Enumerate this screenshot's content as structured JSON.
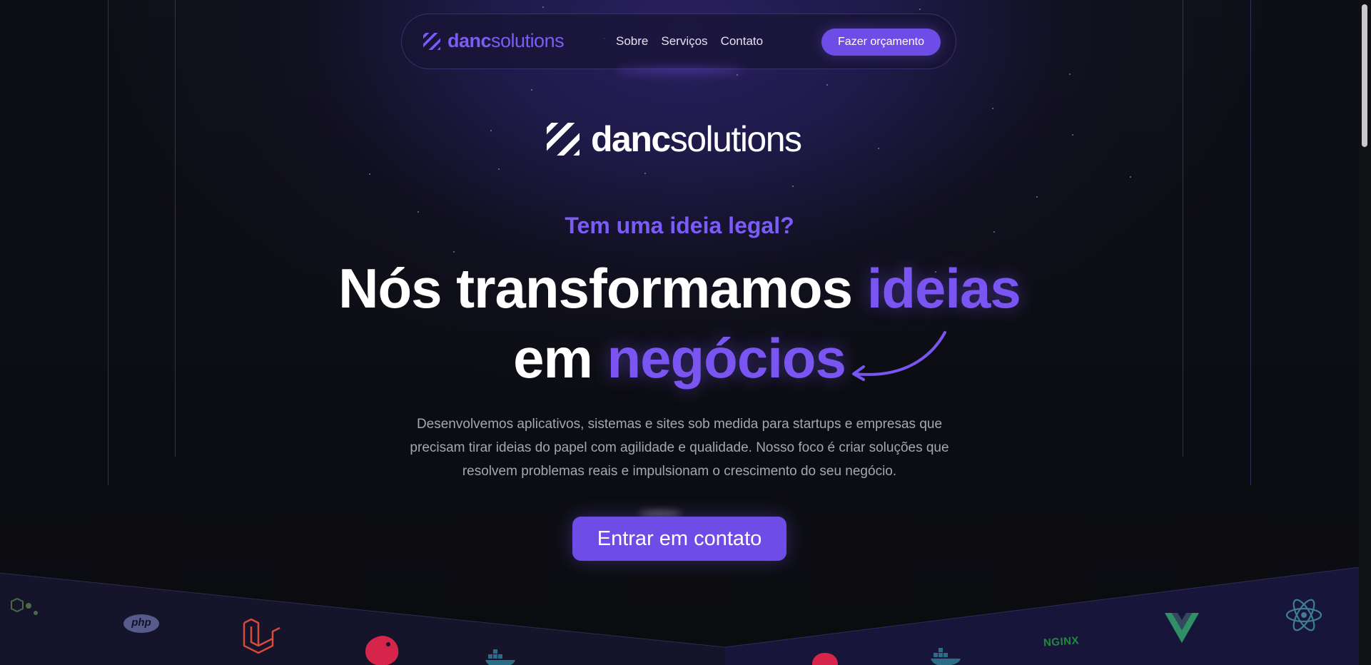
{
  "header": {
    "brand": {
      "bold": "danc",
      "light": "solutions"
    },
    "nav": [
      {
        "label": "Sobre"
      },
      {
        "label": "Serviços"
      },
      {
        "label": "Contato"
      }
    ],
    "cta_label": "Fazer orçamento"
  },
  "hero": {
    "logo": {
      "bold": "danc",
      "light": "solutions"
    },
    "eyebrow": "Tem uma ideia legal?",
    "headline": {
      "part1": "Nós transformamos ",
      "highlight1": "ideias",
      "part2": "em ",
      "highlight2": "negócios"
    },
    "description": "Desenvolvemos aplicativos, sistemas e sites sob medida para startups e empresas que precisam tirar ideias do papel com agilidade e qualidade. Nosso foco é criar soluções que resolvem problemas reais e impulsionam o crescimento do seu negócio.",
    "cta_label": "Entrar em contato"
  },
  "tech_icons": {
    "php_text": "php",
    "nginx_text": "NGINX",
    "items": [
      "node-icon",
      "php-icon",
      "laravel-icon",
      "nestjs-icon",
      "docker-icon",
      "nestjs-icon",
      "docker-icon",
      "nginx-icon",
      "vue-icon",
      "react-icon"
    ]
  },
  "colors": {
    "accent": "#7c5cf6",
    "button": "#6d4de6",
    "background": "#0b0c10",
    "text_muted": "#a6a6b3"
  }
}
